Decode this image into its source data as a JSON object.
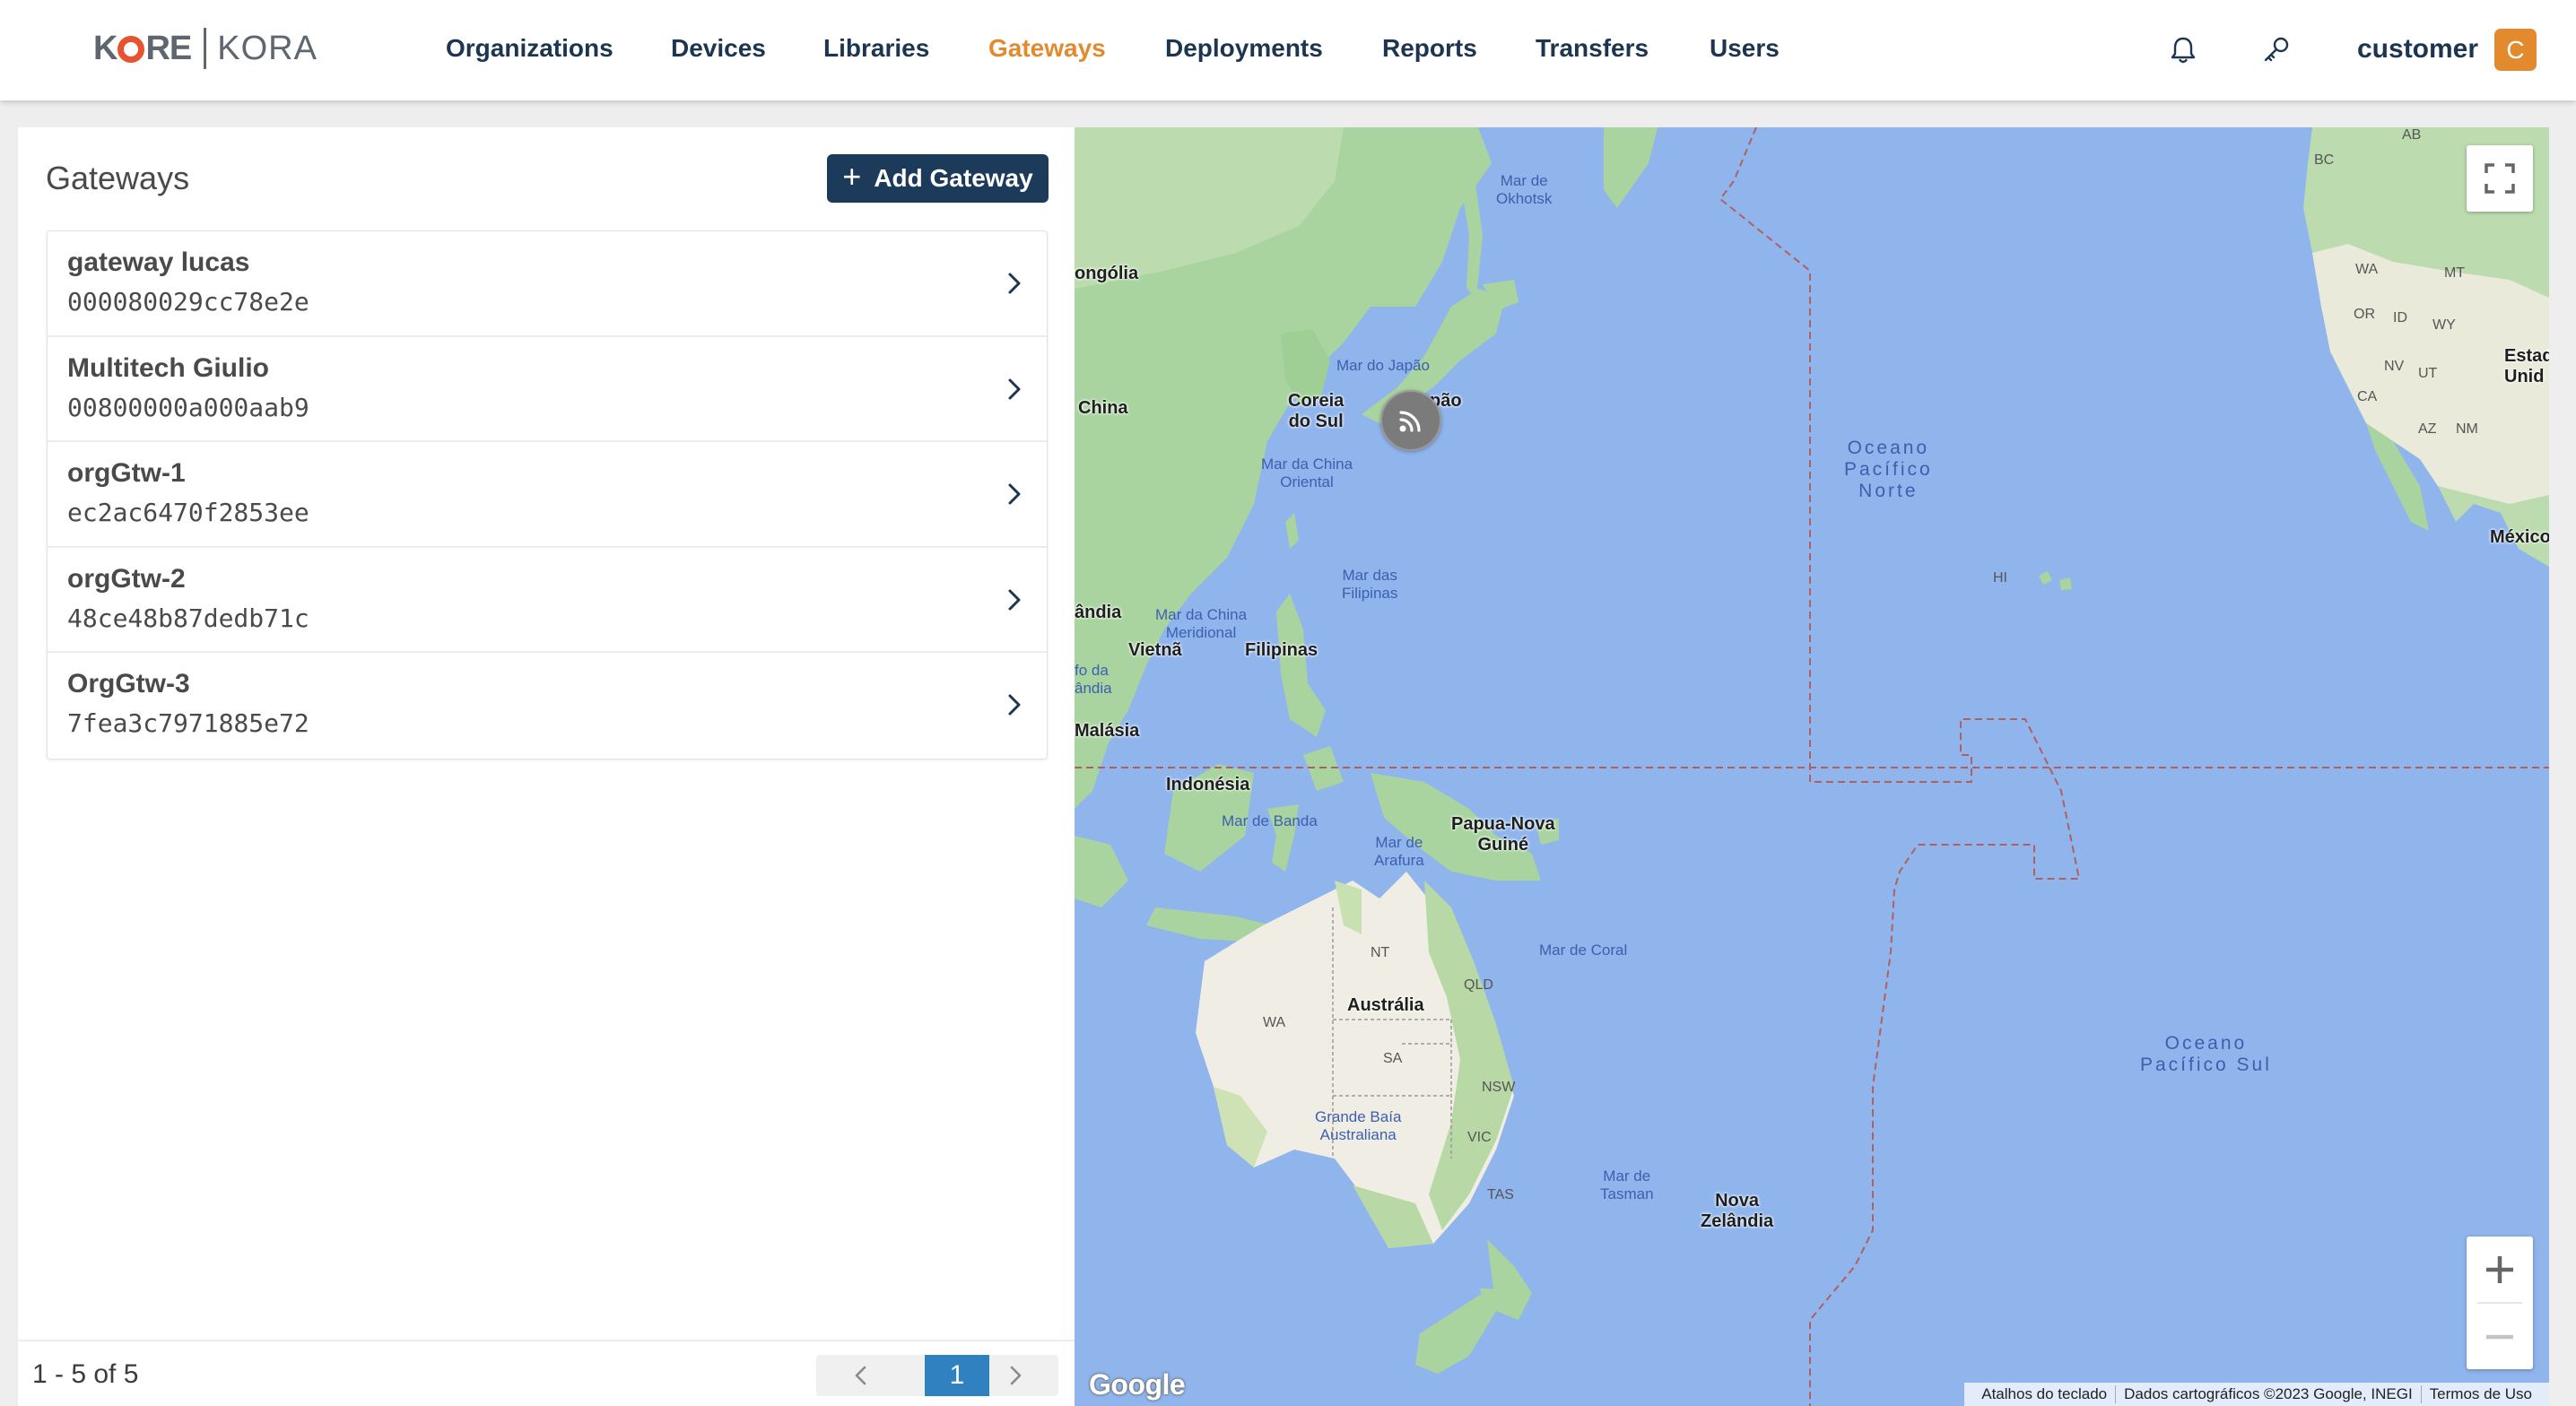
{
  "header": {
    "logo": {
      "brand": "KORE",
      "product": "KORA"
    },
    "nav": [
      {
        "label": "Organizations",
        "active": false
      },
      {
        "label": "Devices",
        "active": false
      },
      {
        "label": "Libraries",
        "active": false
      },
      {
        "label": "Gateways",
        "active": true
      },
      {
        "label": "Deployments",
        "active": false
      },
      {
        "label": "Reports",
        "active": false
      },
      {
        "label": "Transfers",
        "active": false
      },
      {
        "label": "Users",
        "active": false
      }
    ],
    "icons": [
      "bell-icon",
      "key-icon"
    ],
    "user": {
      "name": "customer",
      "avatar_letter": "C"
    }
  },
  "panel": {
    "title": "Gateways",
    "add_button": "Add Gateway",
    "gateways": [
      {
        "name": "gateway lucas",
        "id": "000080029cc78e2e"
      },
      {
        "name": "Multitech Giulio",
        "id": "00800000a000aab9"
      },
      {
        "name": "orgGtw-1",
        "id": "ec2ac6470f2853ee"
      },
      {
        "name": "orgGtw-2",
        "id": "48ce48b87dedb71c"
      },
      {
        "name": "OrgGtw-3",
        "id": "7fea3c7971885e72"
      }
    ],
    "pagination": {
      "summary": "1 - 5 of 5",
      "current_page": "1"
    }
  },
  "map": {
    "labels": {
      "mongolia": "ongólia",
      "china": "China",
      "korea": "Coreia\ndo Sul",
      "japan": "pão",
      "sea_japan": "Mar do Japão",
      "sea_okhotsk": "Mar de\nOkhotsk",
      "sea_east_china": "Mar da China\nOriental",
      "sea_philippine": "Mar das\nFilipinas",
      "sea_south_china": "Mar da China\nMeridional",
      "thailand": "ândia",
      "vietnam": "Vietnã",
      "philippines": "Filipinas",
      "gulf_thailand": "fo da\nândia",
      "malaysia": "Malásia",
      "indonesia": "Indonésia",
      "sea_banda": "Mar de Banda",
      "sea_arafura": "Mar de\nArafura",
      "png": "Papua-Nova\nGuiné",
      "sea_coral": "Mar de Coral",
      "australia": "Austrália",
      "nt": "NT",
      "qld": "QLD",
      "wa": "WA",
      "sa": "SA",
      "nsw": "NSW",
      "vic": "VIC",
      "tas": "TAS",
      "bight": "Grande Baía\nAustraliana",
      "sea_tasman": "Mar de\nTasman",
      "nz": "Nova\nZelândia",
      "north_pacific": "Oceano\nPacífico\nNorte",
      "south_pacific": "Oceano\nPacífico Sul",
      "hi": "HI",
      "usa": "Estad\nUnid",
      "mexico": "México",
      "bc": "BC",
      "ab": "AB",
      "wa_us": "WA",
      "mt": "MT",
      "or": "OR",
      "id": "ID",
      "wy": "WY",
      "nv": "NV",
      "ut": "UT",
      "ca": "CA",
      "az": "AZ",
      "nm": "NM"
    },
    "google": "Google",
    "attribution": [
      "Atalhos do teclado",
      "Dados cartográficos ©2023 Google, INEGI",
      "Termos de Uso"
    ],
    "marker_icon": "rss-icon"
  }
}
